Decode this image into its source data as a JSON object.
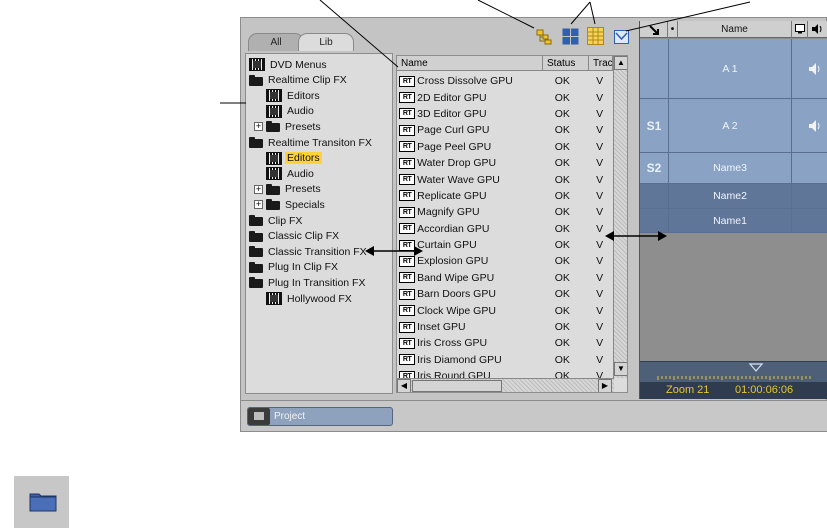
{
  "tabs": [
    {
      "label": "All"
    },
    {
      "label": "Lib"
    }
  ],
  "tree": {
    "items": [
      {
        "label": "DVD Menus",
        "icon": "film-icon",
        "level": 0
      },
      {
        "label": "Realtime Clip FX",
        "icon": "folder-icon",
        "level": 0
      },
      {
        "label": "Editors",
        "icon": "film-icon",
        "level": 1
      },
      {
        "label": "Audio",
        "icon": "film-icon",
        "level": 1
      },
      {
        "label": "Presets",
        "icon": "folder-icon",
        "level": 1
      },
      {
        "label": "Realtime Transiton FX",
        "icon": "folder-icon",
        "level": 0
      },
      {
        "label": "Editors",
        "icon": "film-icon",
        "level": 1,
        "selected": true
      },
      {
        "label": "Audio",
        "icon": "film-icon",
        "level": 1
      },
      {
        "label": "Presets",
        "icon": "folder-icon",
        "level": 1
      },
      {
        "label": "Specials",
        "icon": "folder-icon",
        "level": 1
      },
      {
        "label": "Clip FX",
        "icon": "folder-icon",
        "level": 0
      },
      {
        "label": "Classic Clip FX",
        "icon": "folder-icon",
        "level": 0
      },
      {
        "label": "Classic Transition FX",
        "icon": "folder-icon",
        "level": 0
      },
      {
        "label": "Plug In Clip FX",
        "icon": "folder-icon",
        "level": 0
      },
      {
        "label": "Plug In Transition FX",
        "icon": "folder-icon",
        "level": 0
      },
      {
        "label": "Hollywood FX",
        "icon": "film-icon",
        "level": 1
      }
    ]
  },
  "list": {
    "columns": {
      "name": "Name",
      "status": "Status",
      "track": "Trac"
    },
    "icon_label": "RT",
    "rows": [
      {
        "name": "Cross Dissolve GPU",
        "status": "OK",
        "track": "V"
      },
      {
        "name": "2D Editor GPU",
        "status": "OK",
        "track": "V"
      },
      {
        "name": "3D Editor GPU",
        "status": "OK",
        "track": "V"
      },
      {
        "name": "Page Curl GPU",
        "status": "OK",
        "track": "V"
      },
      {
        "name": "Page Peel GPU",
        "status": "OK",
        "track": "V"
      },
      {
        "name": "Water Drop GPU",
        "status": "OK",
        "track": "V"
      },
      {
        "name": "Water Wave GPU",
        "status": "OK",
        "track": "V"
      },
      {
        "name": "Replicate GPU",
        "status": "OK",
        "track": "V"
      },
      {
        "name": "Magnify GPU",
        "status": "OK",
        "track": "V"
      },
      {
        "name": "Accordian GPU",
        "status": "OK",
        "track": "V"
      },
      {
        "name": "Curtain GPU",
        "status": "OK",
        "track": "V"
      },
      {
        "name": "Explosion GPU",
        "status": "OK",
        "track": "V"
      },
      {
        "name": "Band Wipe GPU",
        "status": "OK",
        "track": "V"
      },
      {
        "name": "Barn Doors GPU",
        "status": "OK",
        "track": "V"
      },
      {
        "name": "Clock Wipe GPU",
        "status": "OK",
        "track": "V"
      },
      {
        "name": "Inset GPU",
        "status": "OK",
        "track": "V"
      },
      {
        "name": "Iris Cross GPU",
        "status": "OK",
        "track": "V"
      },
      {
        "name": "Iris Diamond GPU",
        "status": "OK",
        "track": "V"
      },
      {
        "name": "Iris Round GPU",
        "status": "OK",
        "track": "V"
      }
    ]
  },
  "timeline": {
    "header_name": "Name",
    "tracks": [
      {
        "label": "",
        "name": "A 1",
        "audio": true
      },
      {
        "label": "S1",
        "name": "A 2",
        "audio": true
      },
      {
        "label": "S2",
        "name": "Name3",
        "audio": false
      },
      {
        "label": "",
        "name": "Name2",
        "audio": false
      },
      {
        "label": "",
        "name": "Name1",
        "audio": false
      }
    ],
    "zoom": "Zoom 21",
    "timecode": "01:00:06:06"
  },
  "bottom": {
    "project_label": "Project"
  },
  "colors": {
    "selection": "#ffd23a",
    "track_blue": "#8aa2c4",
    "zoom_text": "#e7c536",
    "marker": "#c23bd6"
  }
}
